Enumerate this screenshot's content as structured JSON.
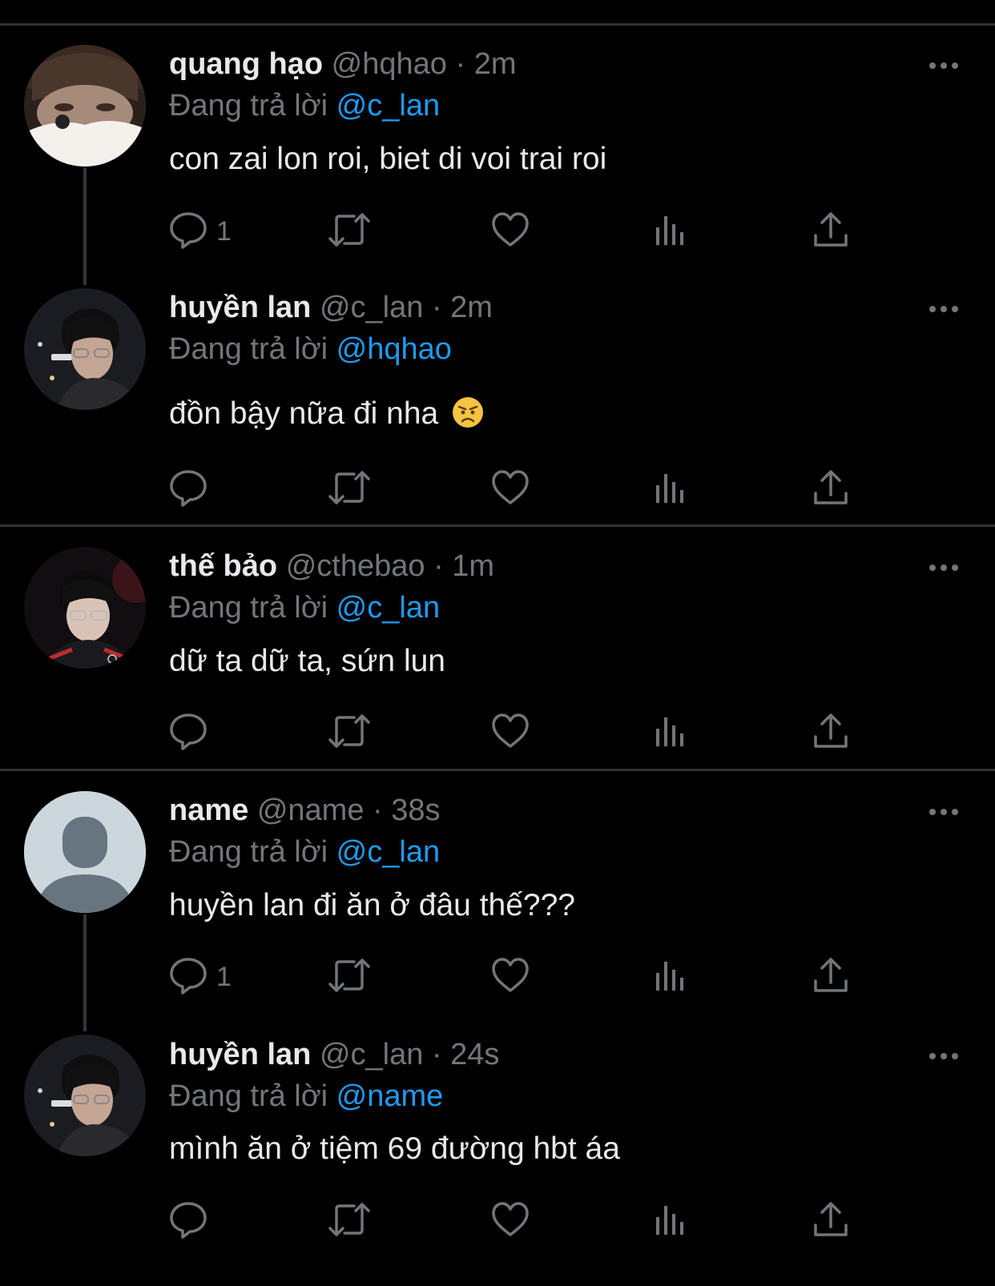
{
  "tweets": [
    {
      "display_name": "quang hạo",
      "handle": "@hqhao",
      "dot": "·",
      "time": "2m",
      "reply_prefix": "Đang trả lời",
      "reply_to": "@c_lan",
      "text": "con zai lon roi, biet di voi trai roi",
      "reply_count": "1"
    },
    {
      "display_name": "huyền lan",
      "handle": "@c_lan",
      "dot": "·",
      "time": "2m",
      "reply_prefix": "Đang trả lời",
      "reply_to": "@hqhao",
      "text": "đồn bậy nữa đi nha",
      "emoji": "angry-face-emoji",
      "reply_count": ""
    },
    {
      "display_name": "thế bảo",
      "handle": "@cthebao",
      "dot": "·",
      "time": "1m",
      "reply_prefix": "Đang trả lời",
      "reply_to": "@c_lan",
      "text": "dữ ta dữ ta, sứn lun",
      "reply_count": ""
    },
    {
      "display_name": "name",
      "handle": "@name",
      "dot": "·",
      "time": "38s",
      "reply_prefix": "Đang trả lời",
      "reply_to": "@c_lan",
      "text": "huyền lan đi ăn ở đâu thế???",
      "reply_count": "1"
    },
    {
      "display_name": "huyền lan",
      "handle": "@c_lan",
      "dot": "·",
      "time": "24s",
      "reply_prefix": "Đang trả lời",
      "reply_to": "@name",
      "text": "mình ăn ở tiệm 69 đường hbt áa",
      "reply_count": ""
    }
  ],
  "icons": {
    "reply": "reply-icon",
    "retweet": "retweet-icon",
    "like": "heart-icon",
    "views": "views-icon",
    "share": "share-icon",
    "more": "more-icon"
  },
  "colors": {
    "background": "#000000",
    "text": "#e7e9ea",
    "muted": "#71767b",
    "mention": "#1d9bf0",
    "divider": "#2f3336"
  }
}
